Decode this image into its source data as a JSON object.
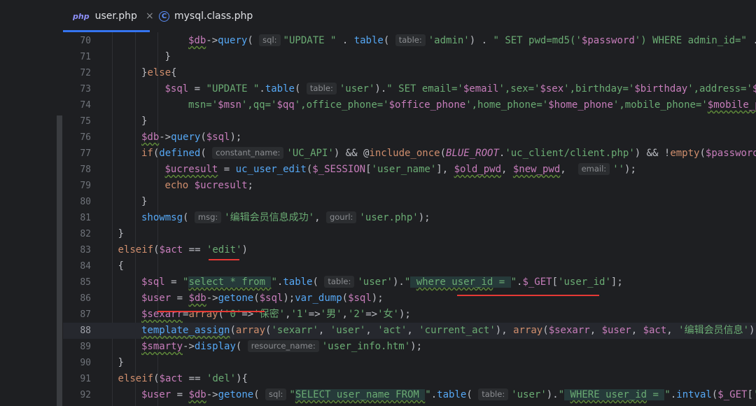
{
  "tabs": [
    {
      "label": "user.php",
      "icon": "php-file-icon",
      "icon_text": "php",
      "active": true,
      "close": "×"
    },
    {
      "label": "mysql.class.php",
      "icon": "class-file-icon",
      "icon_text": "C",
      "active": false
    }
  ],
  "editor": {
    "current_line": 88,
    "lines": [
      {
        "n": "70",
        "html": "<span class=\"var ul\">$db</span>-&gt;<span class=\"fn\">query</span>( <span class=\"hint\">sql:</span><span class=\"str\">\"UPDATE \"</span> . <span class=\"fn\">table</span>( <span class=\"hint\">table:</span><span class=\"str\">'admin'</span>) . <span class=\"str\">\" SET pwd=md5('<span class=\"var\">$password</span>') WHERE admin_id=\"</span> . <span class=\"fn\">in</span>",
        "indent": 4
      },
      {
        "n": "71",
        "html": "}",
        "indent": 3
      },
      {
        "n": "72",
        "html": "}<span class=\"kw\">else</span>{",
        "indent": 2
      },
      {
        "n": "73",
        "html": "<span class=\"var\">$sql</span> = <span class=\"str\">\"UPDATE \"</span>.<span class=\"fn\">table</span>( <span class=\"hint\">table:</span><span class=\"str\">'user'</span>).<span class=\"str\">\" SET email='<span class=\"var\">$email</span>',sex='<span class=\"var\">$sex</span>',birthday='<span class=\"var\">$birthday</span>',address='<span class=\"var\">$ad</span></span>",
        "indent": 3
      },
      {
        "n": "74",
        "html": "<span class=\"str\">msn='<span class=\"var\">$msn</span>',qq='<span class=\"var\">$qq</span>',office_phone='<span class=\"var\">$office_phone</span>',home_phone='<span class=\"var\">$home_phone</span>',mobile_phone='<span class=\"var ul\">$mobile_ph</span></span>",
        "indent": 4
      },
      {
        "n": "75",
        "html": "}",
        "indent": 2
      },
      {
        "n": "76",
        "html": "<span class=\"var ul\">$db</span>-&gt;<span class=\"fn\">query</span>(<span class=\"var\">$sql</span>);",
        "indent": 2
      },
      {
        "n": "77",
        "html": "<span class=\"kw\">if</span>(<span class=\"fn\">defined</span>( <span class=\"hint\">constant_name:</span><span class=\"str\">'UC_API'</span>) &amp;&amp; @<span class=\"kw\">include_once</span>(<span class=\"cst\">BLUE_ROOT</span>.<span class=\"str\">'uc_client/client.php'</span>) &amp;&amp; !<span class=\"kw\">empty</span>(<span class=\"var\">$password</span>))",
        "indent": 2
      },
      {
        "n": "78",
        "html": "<span class=\"var ul\">$ucresult</span> = <span class=\"fn\">uc_user_edit</span>(<span class=\"var\">$_SESSION</span>[<span class=\"str\">'user_name'</span>], <span class=\"var ul\">$old_pwd</span>, <span class=\"var ul\">$new_pwd</span>,  <span class=\"hint\">email:</span><span class=\"str\">''</span>);",
        "indent": 3
      },
      {
        "n": "79",
        "html": "<span class=\"kw\">echo</span> <span class=\"var\">$ucresult</span>;",
        "indent": 3
      },
      {
        "n": "80",
        "html": "}",
        "indent": 2
      },
      {
        "n": "81",
        "html": "<span class=\"fn\">showmsg</span>( <span class=\"hint\">msg:</span><span class=\"str\">'编辑会员信息成功'</span>, <span class=\"hint\">gourl:</span><span class=\"str\">'user.php'</span>);",
        "indent": 2
      },
      {
        "n": "82",
        "html": "}",
        "indent": 1
      },
      {
        "n": "83",
        "html": "<span class=\"kw\">elseif</span>(<span class=\"var\">$act</span> == <span class=\"str\">'edit'</span>)",
        "indent": 1
      },
      {
        "n": "84",
        "html": "{",
        "indent": 1
      },
      {
        "n": "85",
        "html": "<span class=\"var\">$sql</span> = <span class=\"str\">\"<span class=\"sqlbg ul\">select * from </span>\"</span>.<span class=\"fn\">table</span>( <span class=\"hint\">table:</span><span class=\"str\">'user'</span>).<span class=\"str\">\"<span class=\"sqlbg\"> <span class=\"ul\">where user_id</span> = </span>\"</span>.<span class=\"var\">$_GET</span>[<span class=\"str\">'user_id'</span>];",
        "indent": 2
      },
      {
        "n": "86",
        "html": "<span class=\"var\">$user</span> = <span class=\"var ul\">$db</span>-&gt;<span class=\"fn\">getone</span>(<span class=\"var\">$sql</span>);<span class=\"fn\">var_dump</span>(<span class=\"var\">$sql</span>);",
        "indent": 2
      },
      {
        "n": "87",
        "html": "<span class=\"var ul\">$sexarr</span>=<span class=\"kw\">array</span>(<span class=\"str\">'0'</span>=&gt;<span class=\"str\">'保密'</span>,<span class=\"str\">'1'</span>=&gt;<span class=\"str\">'男'</span>,<span class=\"str\">'2'</span>=&gt;<span class=\"str\">'女'</span>);",
        "indent": 2
      },
      {
        "n": "88",
        "html": "<span class=\"fn ul\">template_assign</span>(<span class=\"kw\">array</span>(<span class=\"str\">'sexarr'</span>, <span class=\"str\">'user'</span>, <span class=\"str\">'act'</span>, <span class=\"str\">'current_act'</span>), <span class=\"kw\">array</span>(<span class=\"var\">$sexarr</span>, <span class=\"var\">$user</span>, <span class=\"var\">$act</span>, <span class=\"str\">'编辑会员信息'</span>));",
        "indent": 2
      },
      {
        "n": "89",
        "html": "<span class=\"var ul\">$smarty</span>-&gt;<span class=\"fn\">display</span>( <span class=\"hint\">resource_name:</span><span class=\"str\">'user_info.htm'</span>);",
        "indent": 2
      },
      {
        "n": "90",
        "html": "}",
        "indent": 1
      },
      {
        "n": "91",
        "html": "<span class=\"kw\">elseif</span>(<span class=\"var\">$act</span> == <span class=\"str\">'del'</span>){",
        "indent": 1
      },
      {
        "n": "92",
        "html": "<span class=\"var\">$user</span> = <span class=\"var ul\">$db</span>-&gt;<span class=\"fn\">getone</span>( <span class=\"hint\">sql:</span><span class=\"str\">\"<span class=\"sqlbg ul\">SELECT user_name FROM </span>\"</span>.<span class=\"fn\">table</span>( <span class=\"hint\">table:</span><span class=\"str\">'user'</span>).<span class=\"str\">\"<span class=\"sqlbg\"> <span class=\"ul\">WHERE user_id</span> = </span>\"</span>.<span class=\"fn\">intval</span>(<span class=\"var\">$_GET</span>[<span class=\"str\">'use</span>",
        "indent": 2
      }
    ]
  }
}
